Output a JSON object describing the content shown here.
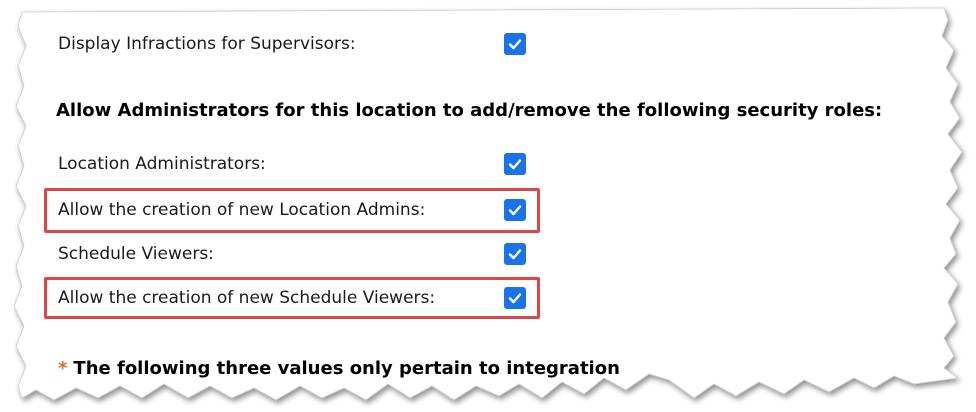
{
  "settings": {
    "display_infractions_label": "Display Infractions for Supervisors:",
    "display_infractions_checked": true,
    "roles_heading": "Allow Administrators for this location to add/remove the following security roles:",
    "location_admins_label": "Location Administrators:",
    "location_admins_checked": true,
    "allow_new_location_admins_label": "Allow the creation of new Location Admins:",
    "allow_new_location_admins_checked": true,
    "schedule_viewers_label": "Schedule Viewers:",
    "schedule_viewers_checked": true,
    "allow_new_schedule_viewers_label": "Allow the creation of new Schedule Viewers:",
    "allow_new_schedule_viewers_checked": true,
    "integration_note_asterisk": "*",
    "integration_note": "The following three values only pertain to integration"
  },
  "colors": {
    "checkbox": "#1a73e8",
    "highlight": "#e04545",
    "asterisk": "#e06a20"
  }
}
